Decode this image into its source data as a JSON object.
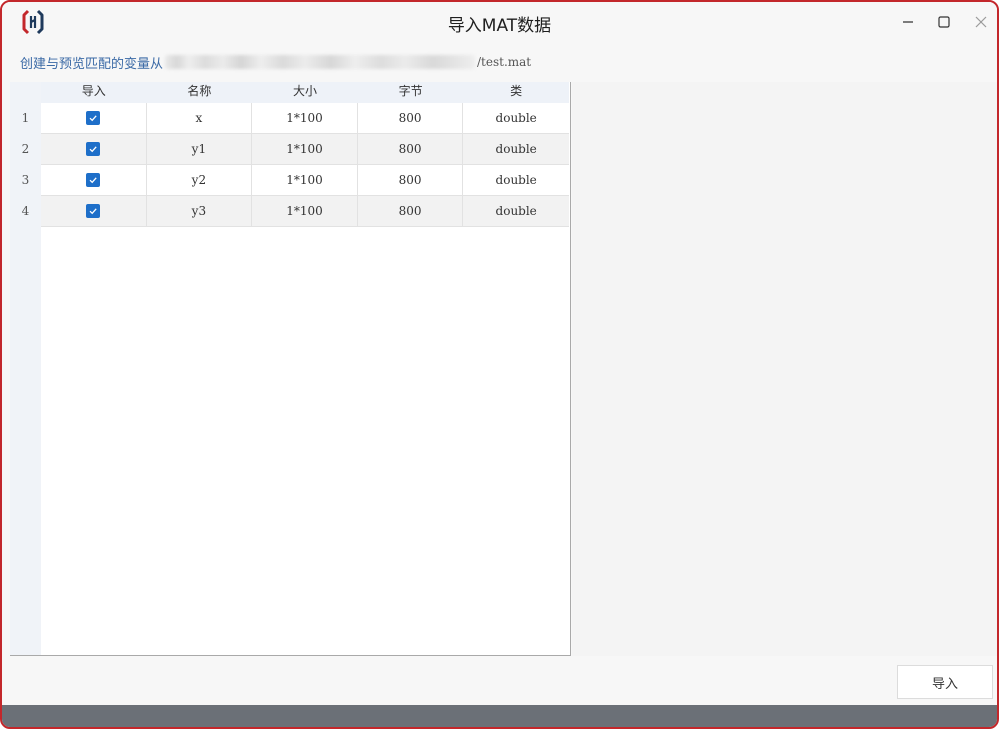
{
  "window": {
    "title": "导入MAT数据",
    "logo_icon": "app-logo-icon",
    "controls": {
      "minimize_icon": "minimize-icon",
      "maximize_icon": "maximize-icon",
      "close_icon": "close-icon"
    }
  },
  "path": {
    "prefix": "创建与预览匹配的变量从",
    "suffix": "/test.mat"
  },
  "table": {
    "columns": [
      "导入",
      "名称",
      "大小",
      "字节",
      "类"
    ],
    "rows": [
      {
        "index": "1",
        "checked": true,
        "name": "x",
        "size": "1*100",
        "bytes": "800",
        "class": "double"
      },
      {
        "index": "2",
        "checked": true,
        "name": "y1",
        "size": "1*100",
        "bytes": "800",
        "class": "double"
      },
      {
        "index": "3",
        "checked": true,
        "name": "y2",
        "size": "1*100",
        "bytes": "800",
        "class": "double"
      },
      {
        "index": "4",
        "checked": true,
        "name": "y3",
        "size": "1*100",
        "bytes": "800",
        "class": "double"
      }
    ]
  },
  "actions": {
    "import_label": "导入"
  },
  "colors": {
    "accent": "#1e6fc9",
    "border": "#c3272b",
    "path_text": "#3b6aa6"
  }
}
